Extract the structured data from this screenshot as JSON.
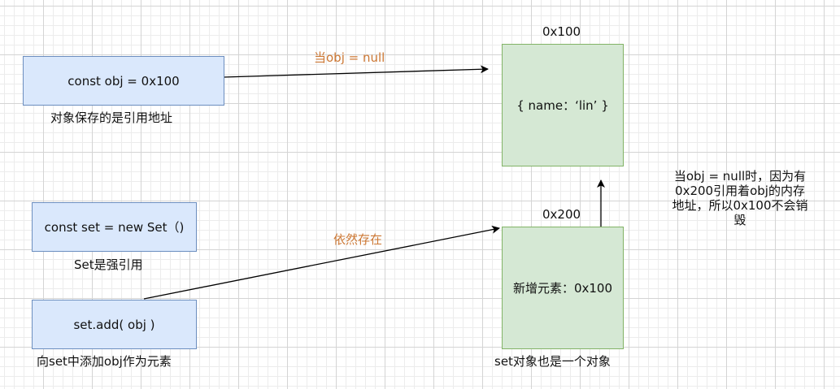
{
  "boxes": {
    "obj_decl": "const obj =  0x100",
    "set_decl": "const set = new Set（)",
    "set_add": "set.add( obj )",
    "obj_value": "{ name：‘lin’ }",
    "set_value": "新增元素：0x100"
  },
  "captions": {
    "obj_decl": "对象保存的是引用地址",
    "set_decl": "Set是强引用",
    "set_add": "向set中添加obj作为元素",
    "set_value": "set对象也是一个对象"
  },
  "addresses": {
    "obj": "0x100",
    "set": "0x200"
  },
  "edge_labels": {
    "obj_null": "当obj = null",
    "still_exists": "依然存在"
  },
  "note": {
    "lines": [
      "当obj = null时，因为有",
      "0x200引用着obj的内存",
      "地址，所以0x100不会销",
      "毁"
    ]
  },
  "colors": {
    "blue_fill": "#dae8fc",
    "blue_stroke": "#6c8ebf",
    "green_fill": "#d5e8d4",
    "green_stroke": "#82b366",
    "edge_label": "#cc7733"
  }
}
